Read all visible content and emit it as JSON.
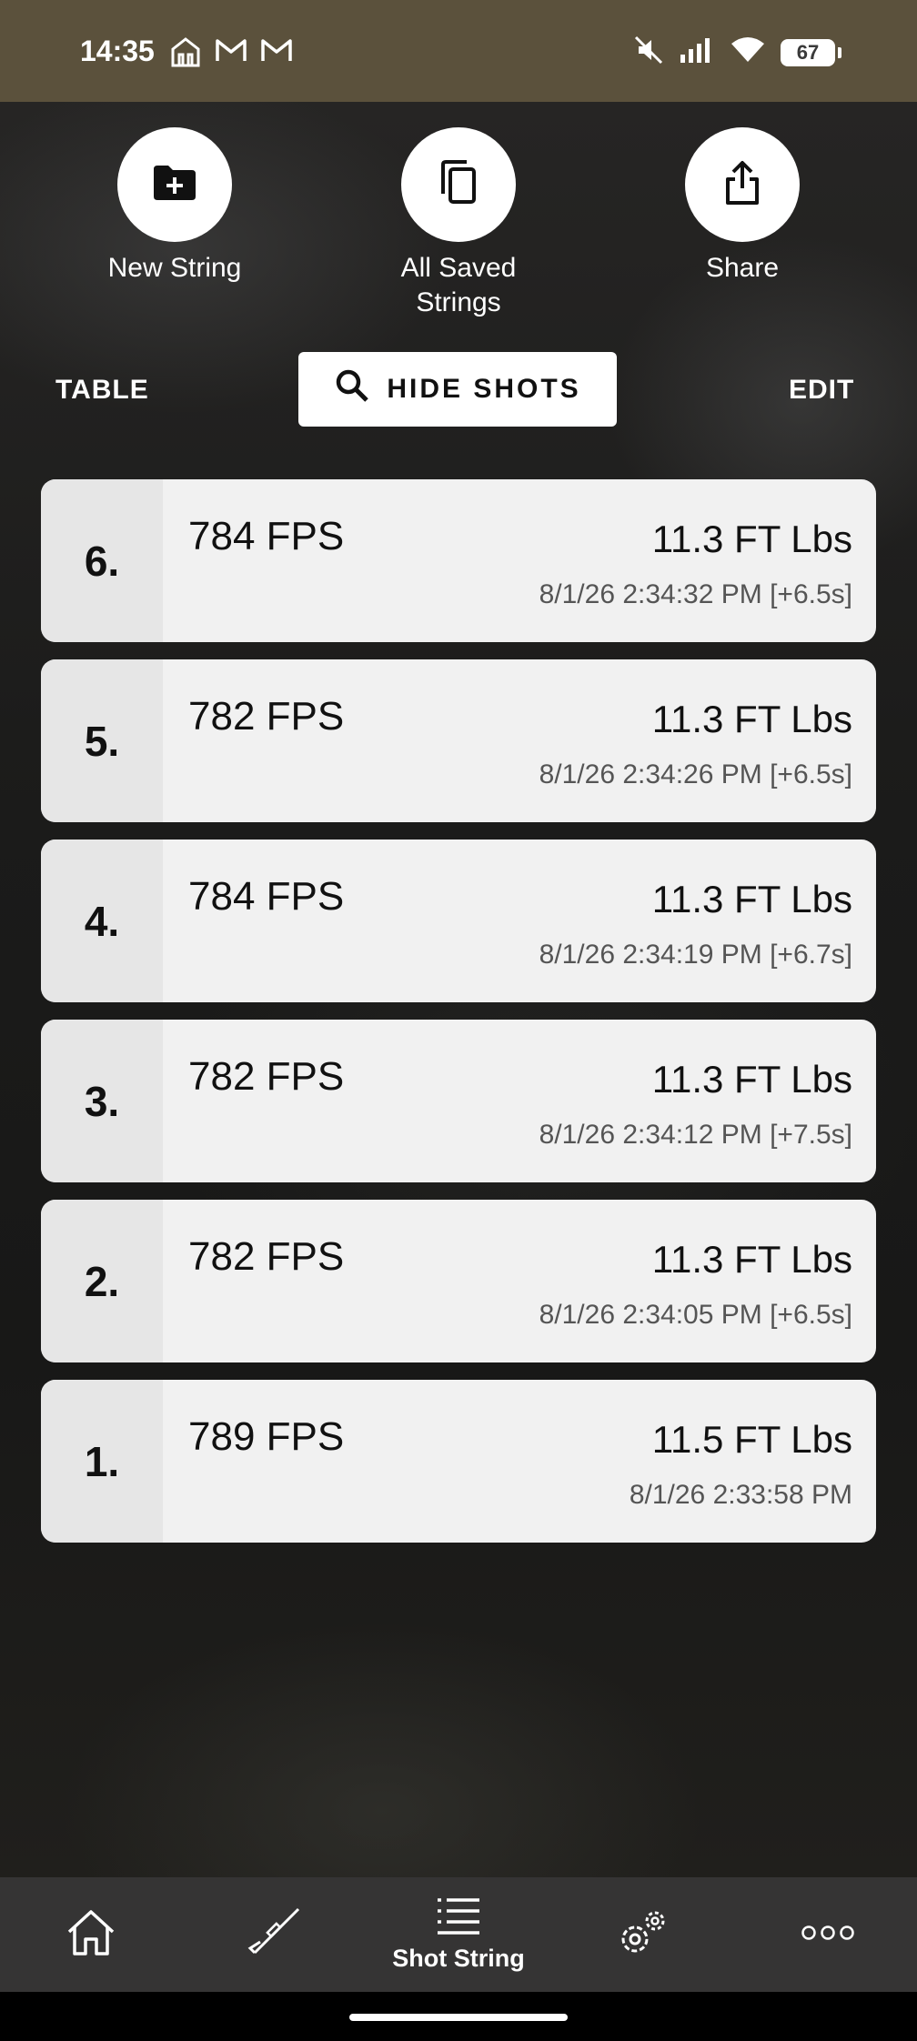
{
  "status_bar": {
    "time": "14:35",
    "left_icons": [
      "notification-app-icon",
      "gmail-icon",
      "gmail-icon"
    ],
    "right_icons": [
      "mute-icon",
      "signal-icon",
      "wifi-icon"
    ],
    "battery": "67"
  },
  "actions": {
    "new_string": "New String",
    "all_saved_line1": "All Saved",
    "all_saved_line2": "Strings",
    "share": "Share"
  },
  "toolbar": {
    "table": "TABLE",
    "hide_shots": "HIDE SHOTS",
    "edit": "EDIT"
  },
  "shots": [
    {
      "num": "6.",
      "fps": "784 FPS",
      "energy": "11.3 FT Lbs",
      "time": "8/1/26 2:34:32 PM [+6.5s]"
    },
    {
      "num": "5.",
      "fps": "782 FPS",
      "energy": "11.3 FT Lbs",
      "time": "8/1/26 2:34:26 PM [+6.5s]"
    },
    {
      "num": "4.",
      "fps": "784 FPS",
      "energy": "11.3 FT Lbs",
      "time": "8/1/26 2:34:19 PM [+6.7s]"
    },
    {
      "num": "3.",
      "fps": "782 FPS",
      "energy": "11.3 FT Lbs",
      "time": "8/1/26 2:34:12 PM [+7.5s]"
    },
    {
      "num": "2.",
      "fps": "782 FPS",
      "energy": "11.3 FT Lbs",
      "time": "8/1/26 2:34:05 PM [+6.5s]"
    },
    {
      "num": "1.",
      "fps": "789 FPS",
      "energy": "11.5 FT Lbs",
      "time": "8/1/26 2:33:58 PM"
    }
  ],
  "bottom_nav": {
    "items": [
      {
        "icon": "home-icon"
      },
      {
        "icon": "rifle-icon"
      },
      {
        "icon": "list-icon",
        "label": "Shot String",
        "active": true
      },
      {
        "icon": "settings-icon"
      },
      {
        "icon": "more-icon"
      }
    ]
  },
  "colors": {
    "status_bar": "#5b513c",
    "card": "#f1f1f1",
    "nav_bg": "#353434"
  }
}
